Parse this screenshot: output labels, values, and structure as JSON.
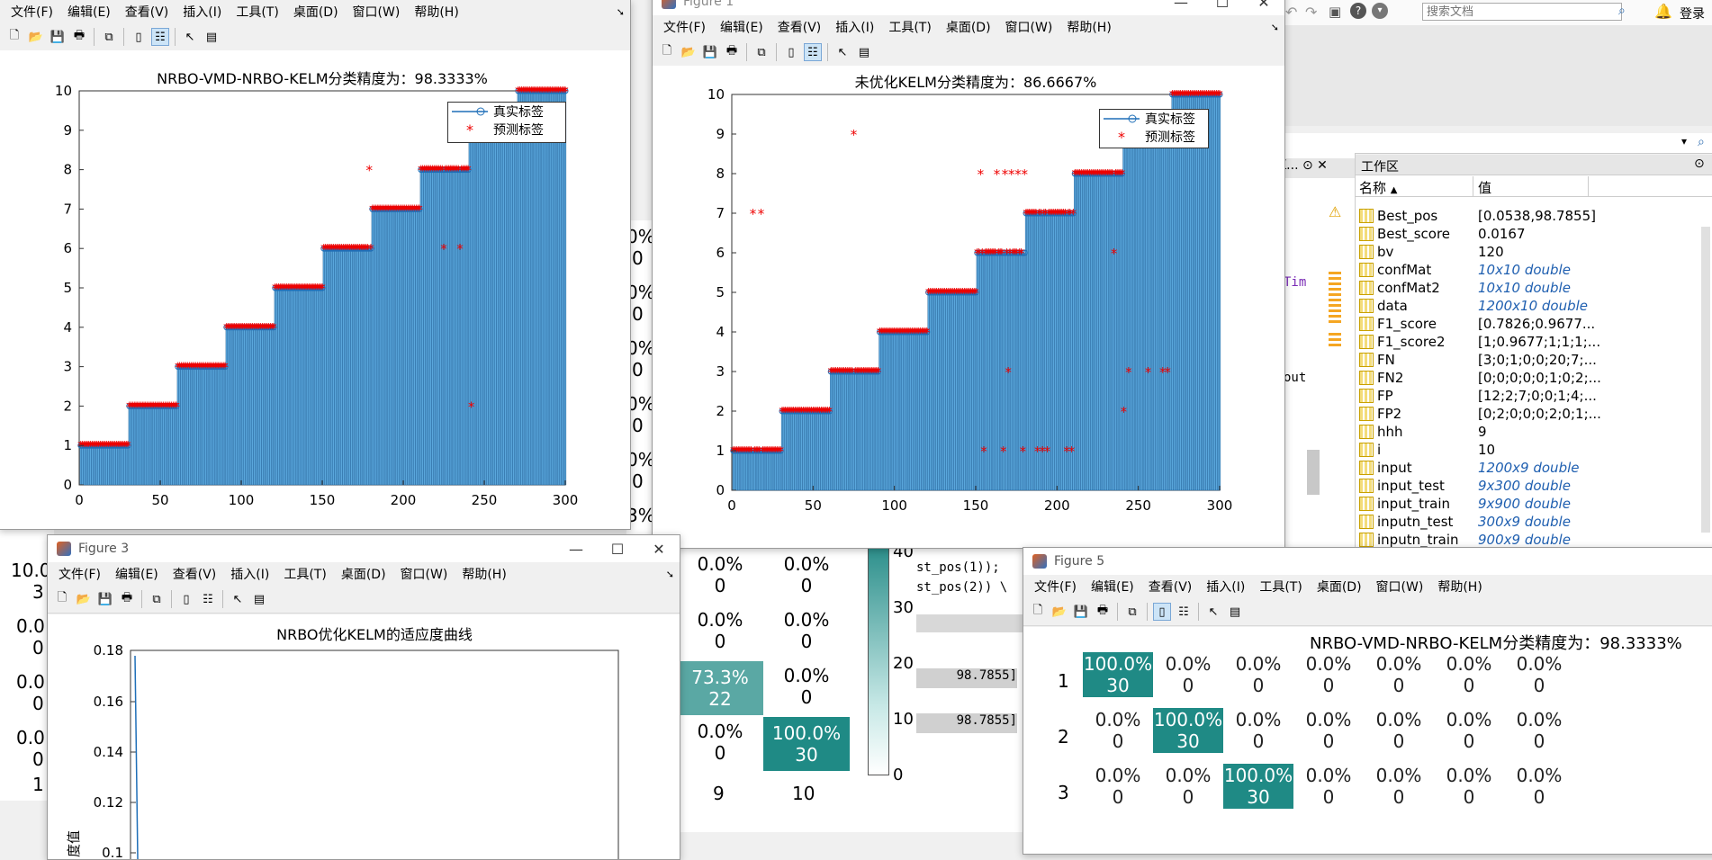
{
  "menus": [
    "文件(F)",
    "编辑(E)",
    "查看(V)",
    "插入(I)",
    "工具(T)",
    "桌面(D)",
    "窗口(W)",
    "帮助(H)"
  ],
  "search": {
    "placeholder": "搜索文档"
  },
  "login_label": "登录",
  "figure_top_left": {
    "title": "NRBO-VMD-NRBO-KELM分类精度为：98.3333%",
    "legend": [
      "真实标签",
      "预测标签"
    ]
  },
  "figure_top_right": {
    "window_title": "Figure 1",
    "title": "未优化KELM分类精度为：86.6667%",
    "legend": [
      "真实标签",
      "预测标签"
    ]
  },
  "figure3": {
    "window_title": "Figure 3",
    "title": "NRBO优化KELM的适应度曲线",
    "ylabel_fragment": "度值",
    "yticks": [
      "0.18",
      "0.16",
      "0.14",
      "0.12",
      "0.1"
    ]
  },
  "figure5": {
    "window_title": "Figure 5",
    "title": "NRBO-VMD-NRBO-KELM分类精度为：98.3333%",
    "row_labels": [
      "1",
      "2",
      "3"
    ]
  },
  "workspace": {
    "title": "工作区",
    "col_name": "名称",
    "col_value": "值",
    "variables": [
      {
        "name": "Best_pos",
        "value": "[0.0538,98.7855]",
        "italic": false
      },
      {
        "name": "Best_score",
        "value": "0.0167",
        "italic": false
      },
      {
        "name": "bv",
        "value": "120",
        "italic": false
      },
      {
        "name": "confMat",
        "value": "10x10 double",
        "italic": true
      },
      {
        "name": "confMat2",
        "value": "10x10 double",
        "italic": true
      },
      {
        "name": "data",
        "value": "1200x10 double",
        "italic": true
      },
      {
        "name": "F1_score",
        "value": "[0.7826;0.9677...",
        "italic": false
      },
      {
        "name": "F1_score2",
        "value": "[1;0.9677;1;1;1;...",
        "italic": false
      },
      {
        "name": "FN",
        "value": "[3;0;1;0;0;20;7;...",
        "italic": false
      },
      {
        "name": "FN2",
        "value": "[0;0;0;0;0;1;0;2;...",
        "italic": false
      },
      {
        "name": "FP",
        "value": "[12;2;7;0;0;1;4;...",
        "italic": false
      },
      {
        "name": "FP2",
        "value": "[0;2;0;0;0;2;0;1;...",
        "italic": false
      },
      {
        "name": "hhh",
        "value": "9",
        "italic": false
      },
      {
        "name": "i",
        "value": "10",
        "italic": false
      },
      {
        "name": "input",
        "value": "1200x9 double",
        "italic": true
      },
      {
        "name": "input_test",
        "value": "9x300 double",
        "italic": true
      },
      {
        "name": "input_train",
        "value": "9x900 double",
        "italic": true
      },
      {
        "name": "inputn_test",
        "value": "300x9 double",
        "italic": true
      },
      {
        "name": "inputn_train",
        "value": "900x9 double",
        "italic": true
      }
    ]
  },
  "background_fragments": {
    "left_percents": [
      "10.0",
      "3",
      "0.0",
      "0",
      "0.0",
      "0",
      "0.0",
      "0",
      "1"
    ],
    "mid_percents": [
      "0%",
      "0",
      "0%",
      "0",
      "0%",
      "0",
      "0%",
      "0",
      "0%",
      "0",
      "3%"
    ],
    "confusion_partial": [
      {
        "pct": "0.0%",
        "n": "0"
      },
      {
        "pct": "0.0%",
        "n": "0"
      },
      {
        "pct": "0.0%",
        "n": "0"
      },
      {
        "pct": "0.0%",
        "n": "0"
      },
      {
        "pct": "73.3%",
        "n": "22"
      },
      {
        "pct": "0.0%",
        "n": "0"
      },
      {
        "pct": "0.0%",
        "n": "0"
      },
      {
        "pct": "100.0%",
        "n": "30"
      }
    ],
    "x_labels": [
      "9",
      "10"
    ],
    "colorbar_ticks": [
      "40",
      "30",
      "20",
      "10",
      "0"
    ],
    "code_lines": [
      "st_pos(1));",
      "st_pos(2)) \\"
    ],
    "values": [
      "98.7855]",
      "98.7855]"
    ],
    "editor_frags": [
      "Tim",
      "out"
    ],
    "panel_k": "K..."
  },
  "chart_data": [
    {
      "type": "bar",
      "title": "NRBO-VMD-NRBO-KELM分类精度为：98.3333%",
      "series": [
        {
          "name": "真实标签"
        },
        {
          "name": "预测标签"
        }
      ],
      "xlim": [
        0,
        300
      ],
      "ylim": [
        0,
        10
      ],
      "xticks": [
        0,
        50,
        100,
        150,
        200,
        250,
        300
      ],
      "yticks": [
        0,
        1,
        2,
        3,
        4,
        5,
        6,
        7,
        8,
        9,
        10
      ],
      "true_labels_by_class": [
        1,
        2,
        3,
        4,
        5,
        6,
        7,
        8,
        9,
        10
      ],
      "samples_per_class": 30,
      "mispredictions": [
        {
          "x": 179,
          "y": 8
        },
        {
          "x": 225,
          "y": 6
        },
        {
          "x": 235,
          "y": 6
        },
        {
          "x": 242,
          "y": 2
        }
      ]
    },
    {
      "type": "bar",
      "title": "未优化KELM分类精度为：86.6667%",
      "series": [
        {
          "name": "真实标签"
        },
        {
          "name": "预测标签"
        }
      ],
      "xlim": [
        0,
        300
      ],
      "ylim": [
        0,
        10
      ],
      "xticks": [
        0,
        50,
        100,
        150,
        200,
        250,
        300
      ],
      "yticks": [
        0,
        1,
        2,
        3,
        4,
        5,
        6,
        7,
        8,
        9,
        10
      ],
      "samples_per_class": 30,
      "mispredictions": [
        {
          "x": 13,
          "y": 7
        },
        {
          "x": 18,
          "y": 7
        },
        {
          "x": 75,
          "y": 9
        },
        {
          "x": 153,
          "y": 8
        },
        {
          "x": 155,
          "y": 7
        },
        {
          "x": 163,
          "y": 8
        },
        {
          "x": 168,
          "y": 8
        },
        {
          "x": 172,
          "y": 8
        },
        {
          "x": 176,
          "y": 8
        },
        {
          "x": 180,
          "y": 8
        },
        {
          "x": 155,
          "y": 1
        },
        {
          "x": 167,
          "y": 1
        },
        {
          "x": 170,
          "y": 3
        },
        {
          "x": 179,
          "y": 1
        },
        {
          "x": 188,
          "y": 1
        },
        {
          "x": 191,
          "y": 1
        },
        {
          "x": 194,
          "y": 1
        },
        {
          "x": 206,
          "y": 1
        },
        {
          "x": 209,
          "y": 1
        },
        {
          "x": 235,
          "y": 6
        },
        {
          "x": 241,
          "y": 2
        },
        {
          "x": 244,
          "y": 3
        },
        {
          "x": 256,
          "y": 3
        },
        {
          "x": 265,
          "y": 3
        },
        {
          "x": 268,
          "y": 3
        }
      ]
    },
    {
      "type": "line",
      "title": "NRBO优化KELM的适应度曲线",
      "yticks": [
        0.1,
        0.12,
        0.14,
        0.16,
        0.18
      ],
      "series": [
        {
          "values": [
            0.163,
            0.1
          ]
        }
      ]
    },
    {
      "type": "heatmap",
      "title": "NRBO-VMD-NRBO-KELM分类精度为：98.3333%",
      "row_labels": [
        "1",
        "2",
        "3"
      ],
      "cells": [
        [
          {
            "pct": "100.0%",
            "n": "30"
          },
          {
            "pct": "0.0%",
            "n": "0"
          },
          {
            "pct": "0.0%",
            "n": "0"
          },
          {
            "pct": "0.0%",
            "n": "0"
          },
          {
            "pct": "0.0%",
            "n": "0"
          },
          {
            "pct": "0.0%",
            "n": "0"
          },
          {
            "pct": "0.0%",
            "n": "0"
          }
        ],
        [
          {
            "pct": "0.0%",
            "n": "0"
          },
          {
            "pct": "100.0%",
            "n": "30"
          },
          {
            "pct": "0.0%",
            "n": "0"
          },
          {
            "pct": "0.0%",
            "n": "0"
          },
          {
            "pct": "0.0%",
            "n": "0"
          },
          {
            "pct": "0.0%",
            "n": "0"
          },
          {
            "pct": "0.0%",
            "n": "0"
          }
        ],
        [
          {
            "pct": "0.0%",
            "n": "0"
          },
          {
            "pct": "0.0%",
            "n": "0"
          },
          {
            "pct": "100.0%",
            "n": "30"
          },
          {
            "pct": "0.0%",
            "n": "0"
          },
          {
            "pct": "0.0%",
            "n": "0"
          },
          {
            "pct": "0.0%",
            "n": "0"
          },
          {
            "pct": "0.0%",
            "n": "0"
          }
        ]
      ]
    }
  ]
}
